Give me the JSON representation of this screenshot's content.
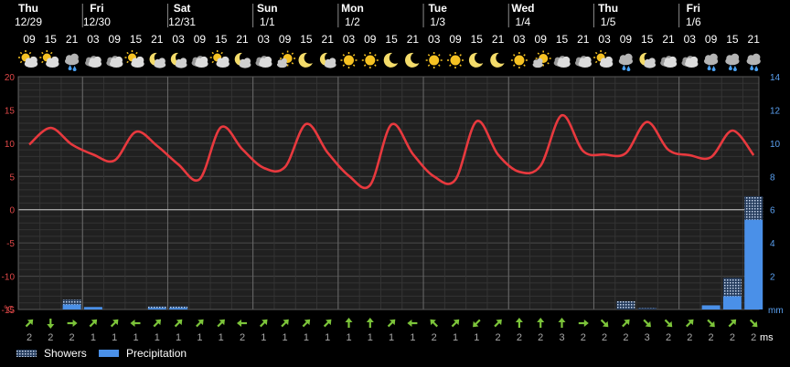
{
  "days": [
    {
      "name": "Thu",
      "date": "12/29"
    },
    {
      "name": "Fri",
      "date": "12/30"
    },
    {
      "name": "Sat",
      "date": "12/31"
    },
    {
      "name": "Sun",
      "date": "1/1"
    },
    {
      "name": "Mon",
      "date": "1/2"
    },
    {
      "name": "Tue",
      "date": "1/3"
    },
    {
      "name": "Wed",
      "date": "1/4"
    },
    {
      "name": "Thu",
      "date": "1/5"
    },
    {
      "name": "Fri",
      "date": "1/6"
    }
  ],
  "hours": [
    "09",
    "15",
    "21",
    "03",
    "09",
    "15",
    "21",
    "03",
    "09",
    "15",
    "21",
    "03",
    "09",
    "15",
    "21",
    "03",
    "09",
    "15",
    "21",
    "03",
    "09",
    "15",
    "21",
    "03",
    "09",
    "15",
    "21",
    "03",
    "09",
    "15",
    "21",
    "03",
    "09",
    "15",
    "21"
  ],
  "icons": [
    "partly-sunny-icon",
    "partly-sunny-icon",
    "rain-cloud-icon",
    "cloud-icon",
    "cloud-icon",
    "partly-sunny-icon",
    "moon-cloud-icon",
    "moon-cloud-icon",
    "cloud-icon",
    "partly-sunny-icon",
    "moon-cloud-icon",
    "cloud-icon",
    "sun-cloud-icon",
    "moon-icon",
    "moon-cloud-icon",
    "sun-icon",
    "sun-icon",
    "moon-icon",
    "moon-icon",
    "sun-icon",
    "sun-icon",
    "moon-icon",
    "moon-icon",
    "sun-icon",
    "sun-cloud-icon",
    "cloud-icon",
    "cloud-icon",
    "partly-sunny-icon",
    "rain-cloud-icon",
    "moon-cloud-icon",
    "cloud-icon",
    "cloud-icon",
    "rain-cloud-icon",
    "rain-cloud-icon",
    "rain-cloud-icon"
  ],
  "chart_data": {
    "type": "line",
    "temperature": {
      "x_index": [
        0,
        1,
        2,
        3,
        4,
        5,
        6,
        7,
        8,
        9,
        10,
        11,
        12,
        13,
        14,
        15,
        16,
        17,
        18,
        19,
        20,
        21,
        22,
        23,
        24,
        25,
        26,
        27,
        28,
        29,
        30,
        31,
        32,
        33,
        34
      ],
      "values": [
        9.8,
        12.3,
        9.8,
        8.3,
        7.4,
        11.7,
        9.6,
        6.8,
        4.6,
        12.4,
        9.1,
        6.3,
        6.4,
        12.9,
        8.6,
        5.1,
        3.7,
        12.8,
        8.4,
        5.0,
        4.5,
        13.3,
        8.3,
        5.7,
        6.6,
        14.2,
        8.8,
        8.3,
        8.5,
        13.2,
        9.0,
        8.2,
        7.9,
        11.9,
        8.2
      ],
      "units": "°C",
      "color": "#e8393e"
    },
    "precipitation": {
      "values": [
        0,
        0,
        0.3,
        0.15,
        0,
        0,
        0.1,
        0.1,
        0,
        0,
        0,
        0,
        0,
        0,
        0,
        0,
        0,
        0,
        0,
        0,
        0,
        0,
        0,
        0,
        0,
        0,
        0,
        0,
        0,
        0,
        0,
        0,
        0.25,
        0.8,
        5.4
      ],
      "color": "#4a90e8"
    },
    "showers": {
      "values": [
        0,
        0,
        0.3,
        0,
        0,
        0,
        0.1,
        0.1,
        0,
        0,
        0,
        0,
        0,
        0,
        0,
        0,
        0,
        0,
        0,
        0,
        0,
        0,
        0,
        0,
        0,
        0,
        0,
        0,
        0.5,
        0.1,
        0,
        0,
        0,
        1.1,
        1.4
      ],
      "color": "#a0b4d0"
    },
    "y_left": {
      "ticks": [
        "20",
        "15",
        "10",
        "5",
        "0",
        "-5",
        "-10",
        "-15"
      ],
      "min": -15,
      "max": 20,
      "unit_label": "°C"
    },
    "y_right": {
      "ticks": [
        "14",
        "12",
        "10",
        "8",
        "6",
        "4",
        "2"
      ],
      "min": 0,
      "max": 14,
      "unit_label": "mm"
    },
    "grid": true,
    "legend": [
      "Showers",
      "Precipitation"
    ]
  },
  "wind": {
    "directions": [
      45,
      180,
      90,
      45,
      45,
      270,
      45,
      45,
      45,
      45,
      270,
      45,
      45,
      45,
      45,
      0,
      0,
      45,
      270,
      315,
      45,
      225,
      45,
      0,
      0,
      0,
      90,
      135,
      45,
      135,
      135,
      45,
      135,
      45,
      135
    ],
    "speeds": [
      "2",
      "2",
      "2",
      "1",
      "1",
      "1",
      "1",
      "1",
      "1",
      "1",
      "2",
      "1",
      "1",
      "1",
      "1",
      "1",
      "1",
      "1",
      "1",
      "2",
      "1",
      "1",
      "2",
      "2",
      "2",
      "3",
      "2",
      "2",
      "2",
      "3",
      "2",
      "2",
      "2",
      "2",
      "2"
    ],
    "unit": "ms",
    "color": "#7cc43a"
  },
  "legend": {
    "showers": "Showers",
    "precipitation": "Precipitation"
  }
}
